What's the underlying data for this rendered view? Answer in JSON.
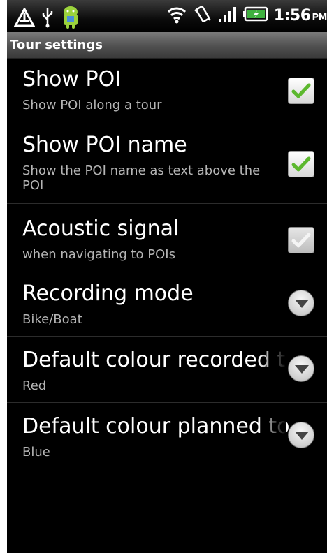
{
  "statusbar": {
    "time": "1:56",
    "ampm": "PM",
    "left_icons": [
      "warning-icon",
      "usb-icon",
      "android-icon"
    ],
    "right_icons": [
      "wifi-icon",
      "vibrate-icon",
      "signal-icon",
      "battery-icon"
    ]
  },
  "title": "Tour settings",
  "settings": [
    {
      "title": "Show POI",
      "summary": "Show POI along a tour",
      "control": "checkbox",
      "checked": true,
      "enabled": true
    },
    {
      "title": "Show POI name",
      "summary": "Show the POI name as text above the POI",
      "control": "checkbox",
      "checked": true,
      "enabled": true
    },
    {
      "title": "Acoustic signal",
      "summary": "when navigating to POIs",
      "control": "checkbox",
      "checked": true,
      "enabled": false
    },
    {
      "title": "Recording mode",
      "summary": "Bike/Boat",
      "control": "dropdown"
    },
    {
      "title": "Default colour recorded t",
      "summary": "Red",
      "control": "dropdown"
    },
    {
      "title": "Default colour planned to",
      "summary": "Blue",
      "control": "dropdown"
    }
  ],
  "colors": {
    "background": "#000000",
    "check_green": "#5cb82e",
    "summary_text": "#b5b5b5"
  }
}
